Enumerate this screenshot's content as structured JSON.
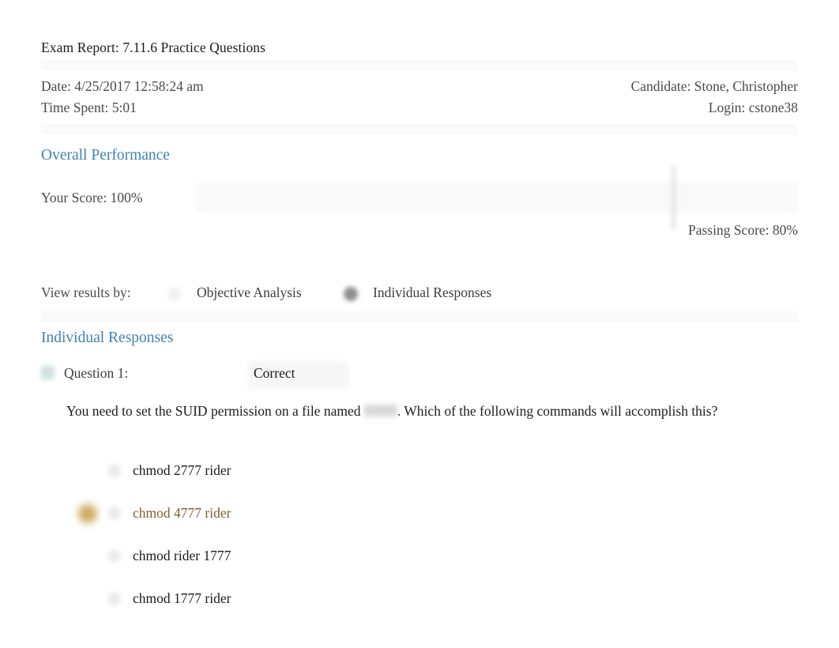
{
  "report": {
    "title": "Exam Report: 7.11.6 Practice Questions",
    "date_label": "Date: 4/25/2017 12:58:24 am",
    "time_spent_label": "Time Spent: 5:01",
    "candidate_label": "Candidate: Stone, Christopher",
    "login_label": "Login: cstone38"
  },
  "overall": {
    "heading": "Overall Performance",
    "your_score_label": "Your Score: 100%",
    "passing_score_label": "Passing Score: 80%",
    "score_percent": 100,
    "passing_percent": 80,
    "heading_color": "#4082b4"
  },
  "view_results": {
    "label": "View results by:",
    "options": [
      {
        "label": "Objective Analysis",
        "selected": false
      },
      {
        "label": "Individual Responses",
        "selected": true
      }
    ]
  },
  "individual_responses": {
    "heading": "Individual Responses",
    "questions": [
      {
        "number_label": "Question 1:",
        "status_label": "Correct",
        "status_icon": "correct-square-icon",
        "text_before": "You need to set the SUID permission on a file named",
        "redacted_filename": "",
        "text_after": ". Which of the following commands will accomplish this?",
        "options": [
          {
            "label": "chmod 2777 rider",
            "selected": false,
            "marked_correct": false
          },
          {
            "label": "chmod 4777 rider",
            "selected": true,
            "marked_correct": true
          },
          {
            "label": "chmod rider 1777",
            "selected": false,
            "marked_correct": false
          },
          {
            "label": "chmod 1777 rider",
            "selected": false,
            "marked_correct": false
          }
        ]
      }
    ]
  }
}
